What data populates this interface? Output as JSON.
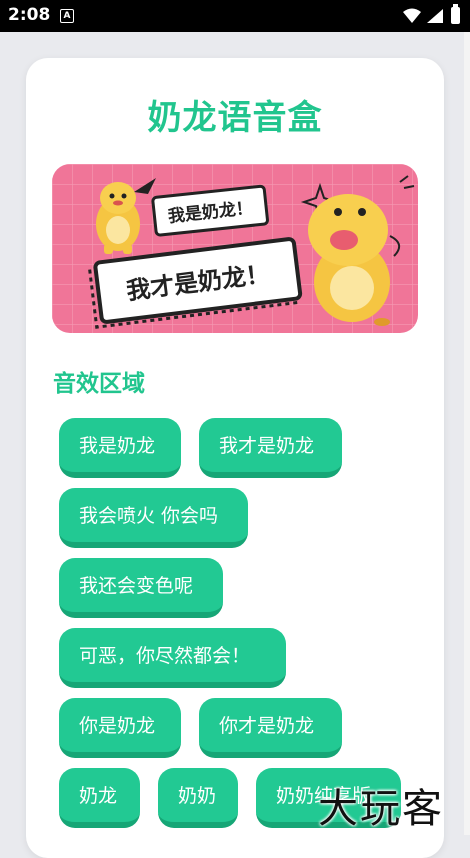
{
  "status_bar": {
    "time": "2:08",
    "notification_badge": "A"
  },
  "app": {
    "title": "奶龙语音盒"
  },
  "banner": {
    "bubble_small": "我是奶龙！",
    "bubble_large": "我才是奶龙！"
  },
  "section": {
    "title": "音效区域"
  },
  "sounds": [
    "我是奶龙",
    "我才是奶龙",
    "我会喷火 你会吗",
    "我还会变色呢",
    "可恶，你尽然都会！",
    "你是奶龙",
    "你才是奶龙",
    "奶龙",
    "奶奶",
    "奶奶纯享版"
  ],
  "watermark": "大玩客",
  "colors": {
    "accent": "#21c58e",
    "button": "#22c993",
    "button_shadow": "#16a676",
    "banner_bg": "#f07598"
  }
}
